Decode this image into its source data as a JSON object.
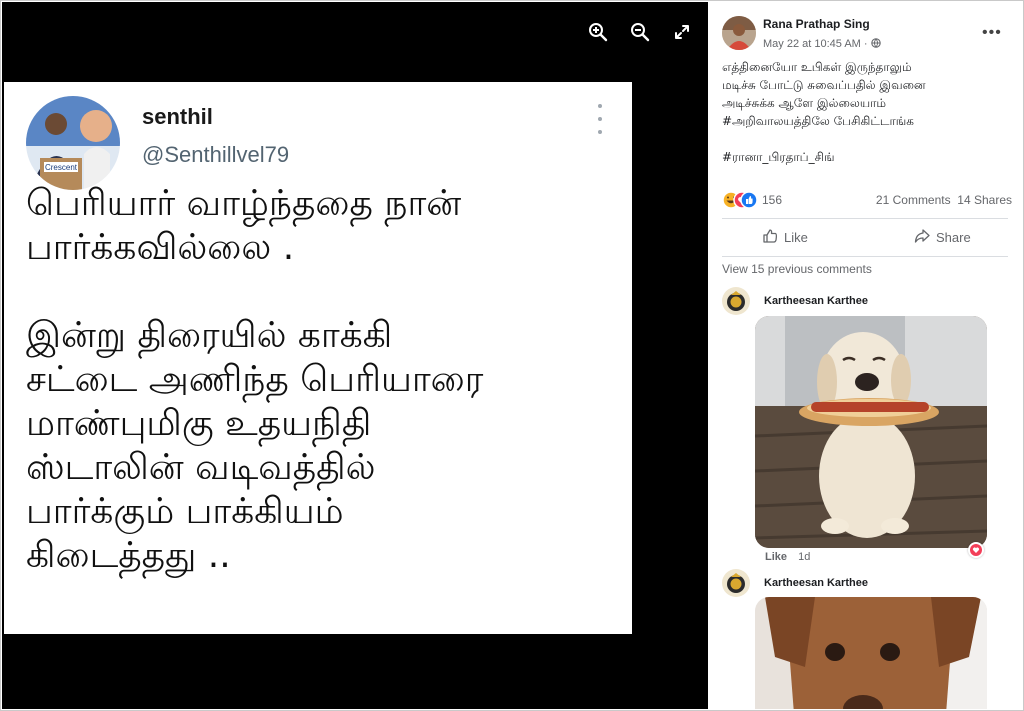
{
  "viewer": {
    "tools": [
      {
        "name": "zoom-in-icon"
      },
      {
        "name": "zoom-out-icon"
      },
      {
        "name": "expand-icon"
      }
    ]
  },
  "tweet": {
    "name": "senthil",
    "handle": "@Senthillvel79",
    "avatar_banner_text": "Crescent",
    "body": "பெரியார் வாழ்ந்ததை நான்\nபார்க்கவில்லை .\n\nஇன்று திரையில் காக்கி\nசட்டை அணிந்த பெரியாரை\nமாண்புமிகு உதயநிதி\nஸ்டாலின் வடிவத்தில்\nபார்க்கும் பாக்கியம்\nகிடைத்தது .."
  },
  "post": {
    "author": "Rana Prathap Sing",
    "timestamp": "May 22 at 10:45 AM",
    "privacy_icon": "globe-icon",
    "more_label": "•••",
    "text": "எத்தினையோ உபிகள் இருந்தாலும்\nமடிச்சு போட்டு சுவைப்பதில் இவனை\nஅடிச்சுக்க ஆளே இல்லையாம்\n#அறிவாலயத்திலே பேசிகிட்டாங்க\n\n#ரானா_பிரதாப்_சிங்",
    "reaction_count": "156",
    "comments_count": "21 Comments",
    "shares_count": "14 Shares",
    "like_label": "Like",
    "share_label": "Share",
    "view_previous": "View 15 previous comments",
    "accent": "#1877f2",
    "haha_color": "#f7b125",
    "love_color": "#f33e58"
  },
  "comments": [
    {
      "author": "Kartheesan Karthee",
      "like_label": "Like",
      "time": "1d"
    },
    {
      "author": "Kartheesan Karthee"
    }
  ]
}
